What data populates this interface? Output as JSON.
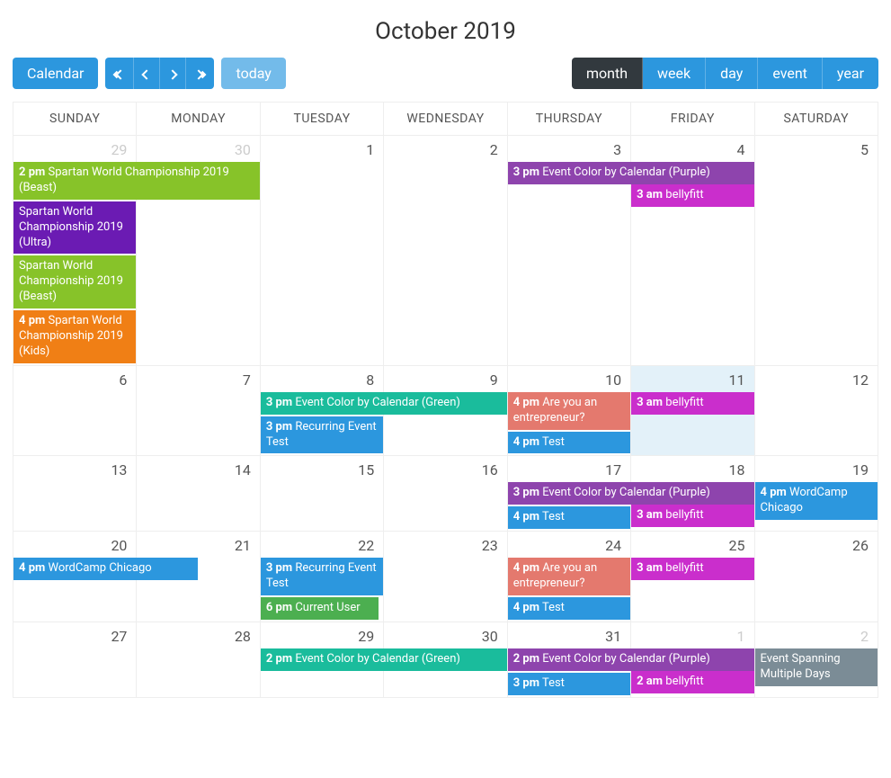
{
  "title": "October 2019",
  "buttons": {
    "calendar": "Calendar",
    "today": "today"
  },
  "views": [
    "month",
    "week",
    "day",
    "event",
    "year"
  ],
  "daysOfWeek": [
    "SUNDAY",
    "MONDAY",
    "TUESDAY",
    "WEDNESDAY",
    "THURSDAY",
    "FRIDAY",
    "SATURDAY"
  ],
  "colors": {
    "green": "#87c329",
    "purple": "#6b1bb3",
    "purple2": "#8e44ad",
    "orange": "#f07f15",
    "magenta": "#ca2ecc",
    "blue": "#2c97de",
    "teal": "#1abc9c",
    "coral": "#e4796e",
    "medgreen": "#4caf50",
    "slate": "#7b8c96"
  },
  "weeks": [
    {
      "days": [
        {
          "num": "29",
          "muted": true,
          "events": [
            {
              "time": "2 pm",
              "title": "Spartan World Championship 2019 (Beast)",
              "color": "green",
              "span": 2
            },
            {
              "time": "",
              "title": "Spartan World Championship 2019 (Ultra)",
              "color": "purple",
              "span": 1
            },
            {
              "time": "",
              "title": "Spartan World Championship 2019 (Beast)",
              "color": "green",
              "span": 1
            },
            {
              "time": "4 pm",
              "title": "Spartan World Championship 2019 (Kids)",
              "color": "orange",
              "span": 1
            }
          ]
        },
        {
          "num": "30",
          "muted": true,
          "events": []
        },
        {
          "num": "1",
          "events": []
        },
        {
          "num": "2",
          "events": []
        },
        {
          "num": "3",
          "events": [
            {
              "time": "3 pm",
              "title": "Event Color by Calendar (Purple)",
              "color": "purple2",
              "span": 2
            }
          ]
        },
        {
          "num": "4",
          "events": [
            {
              "spacer": true
            },
            {
              "time": "3 am",
              "title": "bellyfitt",
              "color": "magenta",
              "span": 1
            }
          ]
        },
        {
          "num": "5",
          "events": []
        }
      ]
    },
    {
      "days": [
        {
          "num": "6",
          "events": []
        },
        {
          "num": "7",
          "events": []
        },
        {
          "num": "8",
          "events": [
            {
              "time": "3 pm",
              "title": "Event Color by Calendar (Green)",
              "color": "teal",
              "span": 2
            },
            {
              "time": "3 pm",
              "title": "Recurring Event Test",
              "color": "blue",
              "span": 1
            }
          ]
        },
        {
          "num": "9",
          "events": []
        },
        {
          "num": "10",
          "events": [
            {
              "time": "4 pm",
              "title": "Are you an entrepreneur?",
              "color": "coral",
              "span": 1
            },
            {
              "time": "4 pm",
              "title": "Test",
              "color": "blue",
              "span": 1
            }
          ]
        },
        {
          "num": "11",
          "highlight": true,
          "events": [
            {
              "time": "3 am",
              "title": "bellyfitt",
              "color": "magenta",
              "span": 1
            }
          ]
        },
        {
          "num": "12",
          "events": []
        }
      ]
    },
    {
      "days": [
        {
          "num": "13",
          "events": []
        },
        {
          "num": "14",
          "events": []
        },
        {
          "num": "15",
          "events": []
        },
        {
          "num": "16",
          "events": []
        },
        {
          "num": "17",
          "events": [
            {
              "time": "3 pm",
              "title": "Event Color by Calendar (Purple)",
              "color": "purple2",
              "span": 2
            },
            {
              "time": "4 pm",
              "title": "Test",
              "color": "blue",
              "span": 1
            }
          ]
        },
        {
          "num": "18",
          "events": [
            {
              "spacer": true
            },
            {
              "time": "3 am",
              "title": "bellyfitt",
              "color": "magenta",
              "span": 1
            }
          ]
        },
        {
          "num": "19",
          "events": [
            {
              "time": "4 pm",
              "title": "WordCamp Chicago",
              "color": "blue",
              "span": 1,
              "twoLine": true
            }
          ]
        }
      ]
    },
    {
      "days": [
        {
          "num": "20",
          "events": [
            {
              "time": "4 pm",
              "title": "WordCamp Chicago",
              "color": "blue",
              "span": 1.5
            }
          ]
        },
        {
          "num": "21",
          "events": []
        },
        {
          "num": "22",
          "events": [
            {
              "time": "3 pm",
              "title": "Recurring Event Test",
              "color": "blue",
              "span": 1
            },
            {
              "time": "6 pm",
              "title": "Current User",
              "color": "medgreen",
              "span": 1,
              "short": true
            }
          ]
        },
        {
          "num": "23",
          "events": []
        },
        {
          "num": "24",
          "events": [
            {
              "time": "4 pm",
              "title": "Are you an entrepreneur?",
              "color": "coral",
              "span": 1
            },
            {
              "time": "4 pm",
              "title": "Test",
              "color": "blue",
              "span": 1
            }
          ]
        },
        {
          "num": "25",
          "events": [
            {
              "time": "3 am",
              "title": "bellyfitt",
              "color": "magenta",
              "span": 1
            }
          ]
        },
        {
          "num": "26",
          "events": []
        }
      ]
    },
    {
      "days": [
        {
          "num": "27",
          "events": []
        },
        {
          "num": "28",
          "events": []
        },
        {
          "num": "29",
          "events": [
            {
              "time": "2 pm",
              "title": "Event Color by Calendar (Green)",
              "color": "teal",
              "span": 2
            }
          ]
        },
        {
          "num": "30",
          "events": []
        },
        {
          "num": "31",
          "events": [
            {
              "time": "2 pm",
              "title": "Event Color by Calendar (Purple)",
              "color": "purple2",
              "span": 2
            },
            {
              "time": "3 pm",
              "title": "Test",
              "color": "blue",
              "span": 1
            }
          ]
        },
        {
          "num": "1",
          "muted": true,
          "events": [
            {
              "spacer": true
            },
            {
              "time": "2 am",
              "title": "bellyfitt",
              "color": "magenta",
              "span": 1
            }
          ]
        },
        {
          "num": "2",
          "muted": true,
          "events": [
            {
              "time": "",
              "title": "Event Spanning Multiple Days",
              "color": "slate",
              "span": 1
            }
          ]
        }
      ]
    }
  ]
}
